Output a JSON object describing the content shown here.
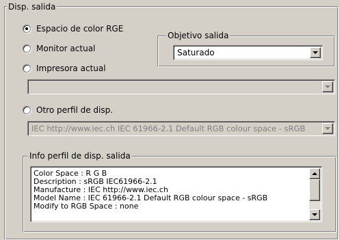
{
  "group_title": "Disp. salida",
  "radios": {
    "color_space": {
      "label": "Espacio de color RGE",
      "selected": true
    },
    "monitor": {
      "label": "Monitor actual",
      "selected": false
    },
    "printer": {
      "label": "Impresora actual",
      "selected": false
    },
    "other_profile": {
      "label": "Otro perfil de disp.",
      "selected": false
    }
  },
  "objective": {
    "title": "Objetivo salida",
    "value": "Saturado"
  },
  "printer_select": {
    "value": ""
  },
  "profile_select": {
    "value": "IEC http://www.iec.ch IEC 61966-2.1 Default RGB colour space - sRGB"
  },
  "info": {
    "title": "Info perfil de disp. salida",
    "lines": [
      "Color Space : R G B",
      "Description : sRGB IEC61966-2.1",
      "Manufacture : IEC http://www.iec.ch",
      "Model Name : IEC 61966-2.1 Default RGB colour space - sRGB",
      "Modify to RGB Space : none"
    ]
  },
  "colors": {
    "face": "#d4d0c8",
    "disabled_text": "#808080"
  }
}
